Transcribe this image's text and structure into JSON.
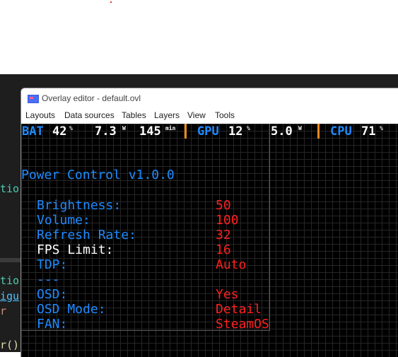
{
  "background_editor": {
    "fragments": [
      "tio",
      "tio",
      "igu",
      "r",
      "r()"
    ]
  },
  "window": {
    "title": "Overlay editor - default.ovl",
    "icon": "overlay-app-icon",
    "menu": [
      "Layouts",
      "Data sources",
      "Tables",
      "Layers",
      "View",
      "Tools"
    ]
  },
  "stats": {
    "bat_label": "BAT",
    "bat_percent": "42",
    "bat_percent_unit": "%",
    "bat_power": "7.3",
    "bat_power_unit": "W",
    "bat_time": "145",
    "bat_time_unit": "min",
    "gpu_label": "GPU",
    "gpu_percent": "12",
    "gpu_percent_unit": "%",
    "gpu_power": "5.0",
    "gpu_power_unit": "W",
    "cpu_label": "CPU",
    "cpu_percent": "71",
    "cpu_percent_unit": "%",
    "separator_color": "#f08a1a"
  },
  "panel": {
    "title": "Power Control v1.0.0",
    "rows": [
      {
        "label": "Brightness:",
        "value": "50",
        "selected": false
      },
      {
        "label": "Volume:",
        "value": "100",
        "selected": false
      },
      {
        "label": "Refresh Rate:",
        "value": "32",
        "selected": false
      },
      {
        "label": "FPS Limit:",
        "value": "16",
        "selected": true
      },
      {
        "label": "TDP:",
        "value": "Auto",
        "selected": false
      },
      {
        "label": "---",
        "value": "",
        "selected": false
      },
      {
        "label": "OSD:",
        "value": "Yes",
        "selected": false
      },
      {
        "label": "OSD Mode:",
        "value": "Detail",
        "selected": false
      },
      {
        "label": "FAN:",
        "value": "SteamOS",
        "selected": false
      }
    ]
  },
  "colors": {
    "label": "#1e8bff",
    "selected_label": "#ffffff",
    "value": "#ff2020",
    "canvas_bg": "#000000"
  }
}
